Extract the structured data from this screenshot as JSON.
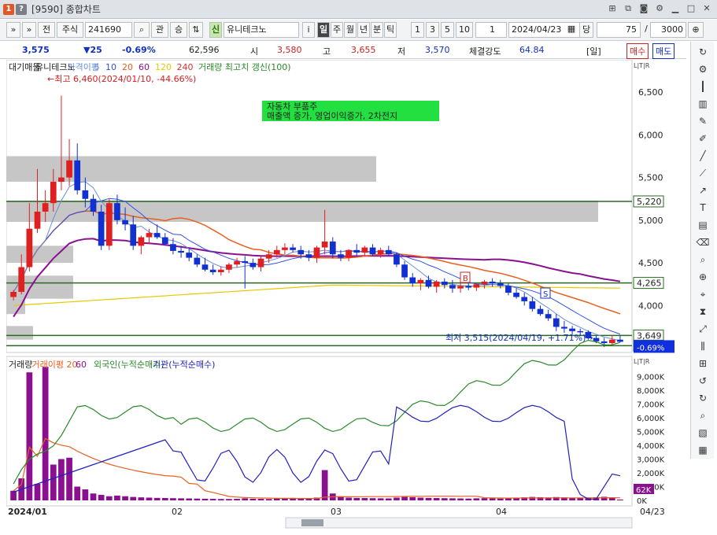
{
  "window": {
    "badge1": "1",
    "badge2": "?",
    "title": "[9590] 종합차트",
    "icons": [
      "pin-icon",
      "link-icon",
      "camera-icon",
      "gear-icon",
      "minimize-icon",
      "maximize-icon",
      "close-icon"
    ],
    "accent": "#e0582a"
  },
  "toolbar": {
    "prev": "»",
    "menu": "»",
    "btn_jeon": "전",
    "btn_jusik": "주식",
    "code": "241690",
    "btn_gwan": "관",
    "btn_seung": "승",
    "new_badge": "신",
    "stock_name": "유니테크노",
    "info": "i",
    "periods": [
      "일",
      "주",
      "월",
      "년",
      "분",
      "틱"
    ],
    "active_period": "일",
    "nums": [
      "1",
      "3",
      "5",
      "10"
    ],
    "count_value": "1",
    "date": "2024/04/23",
    "dang": "당",
    "bars_value": "75",
    "slash": "/",
    "total_value": "3000"
  },
  "quote": {
    "price": "3,575",
    "change": "▼25",
    "change_pct": "-0.69%",
    "volume": "62,596",
    "open_label": "시",
    "open": "3,580",
    "high_label": "고",
    "high": "3,655",
    "low_label": "저",
    "low": "3,570",
    "strength_label": "체결강도",
    "strength": "64.84",
    "period_tag": "[일]",
    "buy_btn": "매수",
    "sell_btn": "매도"
  },
  "price_legend": {
    "items": [
      "대기매물",
      "유니테크노",
      "가격이평",
      "5",
      "10",
      "20",
      "60",
      "120",
      "240",
      "거래량 최고치 갱신(100)"
    ],
    "colors": [
      "#222",
      "#222",
      "#6a8fd8",
      "#6a8fd8",
      "#3050e8",
      "#e86020",
      "#8a1090",
      "#e8c800",
      "#e03030",
      "#2a8a2a"
    ],
    "high_note": "←최고 6,460(2024/01/10, -44.66%)",
    "low_note": "최저 3,515(2024/04/19, +1.71%)→",
    "news_line1": "자동차 부품주",
    "news_line2": "매출액 증가, 영업이익증가, 2차전지",
    "badge_b": "B",
    "badge_s": "S",
    "lines": [
      "5,220",
      "4,265",
      "3,649",
      "3,530"
    ],
    "cur_tag": "-0.69%",
    "axis_mode": "L|T|R"
  },
  "volume_legend": {
    "items": [
      "거래량",
      "거래이평 20",
      "60",
      "외국인(누적순매수)",
      "기관(누적순매수)"
    ],
    "colors": [
      "#222",
      "#e86020",
      "#8a1090",
      "#2a8a2a",
      "#2020c0"
    ],
    "cur_tag": "62K",
    "axis_mode": "L|T|R"
  },
  "x_labels": [
    "2024/01",
    "02",
    "03",
    "04",
    "04/23"
  ],
  "chart_data": {
    "type": "candlestick",
    "price_axis": [
      "6,500",
      "6,000",
      "5,500",
      "5,000",
      "4,500",
      "4,000"
    ],
    "price_range": [
      3450,
      6750
    ],
    "volume_axis": [
      "9,000K",
      "8,000K",
      "7,000K",
      "6,000K",
      "5,000K",
      "4,000K",
      "3,000K",
      "2,000K",
      "1,000K",
      "0K"
    ],
    "volume_range": [
      0,
      10000
    ],
    "candles": [
      [
        4100,
        4180,
        4060,
        4160
      ],
      [
        4160,
        4600,
        4130,
        4450
      ],
      [
        4450,
        5200,
        4400,
        4900
      ],
      [
        4900,
        5600,
        4850,
        5100
      ],
      [
        5100,
        5350,
        4980,
        5200
      ],
      [
        5200,
        5600,
        5100,
        5450
      ],
      [
        5450,
        6460,
        5350,
        5500
      ],
      [
        5500,
        5950,
        5400,
        5700
      ],
      [
        5700,
        5900,
        5300,
        5350
      ],
      [
        5350,
        5500,
        5150,
        5250
      ],
      [
        5250,
        5300,
        5050,
        5100
      ],
      [
        5100,
        5180,
        4650,
        4700
      ],
      [
        4700,
        5250,
        4650,
        5200
      ],
      [
        5200,
        5300,
        4950,
        5000
      ],
      [
        5000,
        5150,
        4880,
        4950
      ],
      [
        4950,
        5050,
        4650,
        4700
      ],
      [
        4700,
        4820,
        4600,
        4800
      ],
      [
        4800,
        4900,
        4720,
        4850
      ],
      [
        4850,
        4950,
        4780,
        4800
      ],
      [
        4800,
        4850,
        4700,
        4720
      ],
      [
        4720,
        4790,
        4600,
        4640
      ],
      [
        4640,
        4700,
        4560,
        4620
      ],
      [
        4620,
        4680,
        4520,
        4560
      ],
      [
        4560,
        4600,
        4450,
        4480
      ],
      [
        4480,
        4560,
        4400,
        4420
      ],
      [
        4420,
        4480,
        4360,
        4390
      ],
      [
        4390,
        4460,
        4350,
        4420
      ],
      [
        4420,
        4500,
        4380,
        4480
      ],
      [
        4480,
        4560,
        4450,
        4520
      ],
      [
        4520,
        4580,
        4200,
        4500
      ],
      [
        4500,
        4550,
        4420,
        4450
      ],
      [
        4450,
        4580,
        4400,
        4550
      ],
      [
        4550,
        4650,
        4500,
        4600
      ],
      [
        4600,
        4700,
        4560,
        4650
      ],
      [
        4650,
        4730,
        4600,
        4680
      ],
      [
        4680,
        4720,
        4620,
        4650
      ],
      [
        4650,
        4700,
        4550,
        4600
      ],
      [
        4600,
        4650,
        4520,
        4560
      ],
      [
        4560,
        4700,
        4500,
        4680
      ],
      [
        4680,
        5120,
        4600,
        4750
      ],
      [
        4750,
        4800,
        4550,
        4600
      ],
      [
        4600,
        4650,
        4520,
        4560
      ],
      [
        4560,
        4660,
        4520,
        4650
      ],
      [
        4650,
        4720,
        4580,
        4620
      ],
      [
        4620,
        4700,
        4580,
        4680
      ],
      [
        4680,
        4720,
        4580,
        4600
      ],
      [
        4600,
        4680,
        4560,
        4650
      ],
      [
        4650,
        4700,
        4580,
        4600
      ],
      [
        4600,
        4620,
        4450,
        4480
      ],
      [
        4480,
        4520,
        4300,
        4330
      ],
      [
        4330,
        4380,
        4220,
        4260
      ],
      [
        4260,
        4320,
        4180,
        4300
      ],
      [
        4300,
        4350,
        4200,
        4220
      ],
      [
        4220,
        4300,
        4150,
        4280
      ],
      [
        4280,
        4320,
        4200,
        4240
      ],
      [
        4240,
        4300,
        4150,
        4200
      ],
      [
        4200,
        4260,
        4150,
        4230
      ],
      [
        4230,
        4280,
        4180,
        4210
      ],
      [
        4210,
        4260,
        4170,
        4250
      ],
      [
        4250,
        4300,
        4200,
        4280
      ],
      [
        4280,
        4320,
        4220,
        4260
      ],
      [
        4260,
        4300,
        4200,
        4230
      ],
      [
        4230,
        4260,
        4120,
        4150
      ],
      [
        4150,
        4200,
        4080,
        4100
      ],
      [
        4100,
        4150,
        4000,
        4050
      ],
      [
        4050,
        4100,
        3930,
        3960
      ],
      [
        3960,
        4000,
        3880,
        3900
      ],
      [
        3900,
        3950,
        3820,
        3850
      ],
      [
        3850,
        3900,
        3700,
        3750
      ],
      [
        3750,
        3820,
        3680,
        3730
      ],
      [
        3730,
        3760,
        3660,
        3700
      ],
      [
        3700,
        3730,
        3640,
        3690
      ],
      [
        3690,
        3710,
        3600,
        3620
      ],
      [
        3620,
        3650,
        3560,
        3580
      ],
      [
        3580,
        3620,
        3515,
        3560
      ],
      [
        3560,
        3655,
        3540,
        3600
      ],
      [
        3600,
        3655,
        3570,
        3575
      ]
    ],
    "volume": [
      700,
      1600,
      9300,
      1200,
      9700,
      2600,
      3000,
      3100,
      1000,
      800,
      500,
      400,
      300,
      350,
      300,
      250,
      220,
      200,
      180,
      170,
      160,
      150,
      140,
      130,
      120,
      110,
      100,
      100,
      110,
      150,
      120,
      110,
      100,
      140,
      160,
      180,
      150,
      120,
      200,
      2200,
      500,
      300,
      200,
      180,
      170,
      160,
      150,
      140,
      200,
      250,
      230,
      200,
      180,
      170,
      160,
      150,
      140,
      130,
      150,
      160,
      140,
      130,
      170,
      200,
      220,
      250,
      230,
      210,
      240,
      220,
      200,
      190,
      210,
      230,
      260,
      200,
      62
    ]
  }
}
